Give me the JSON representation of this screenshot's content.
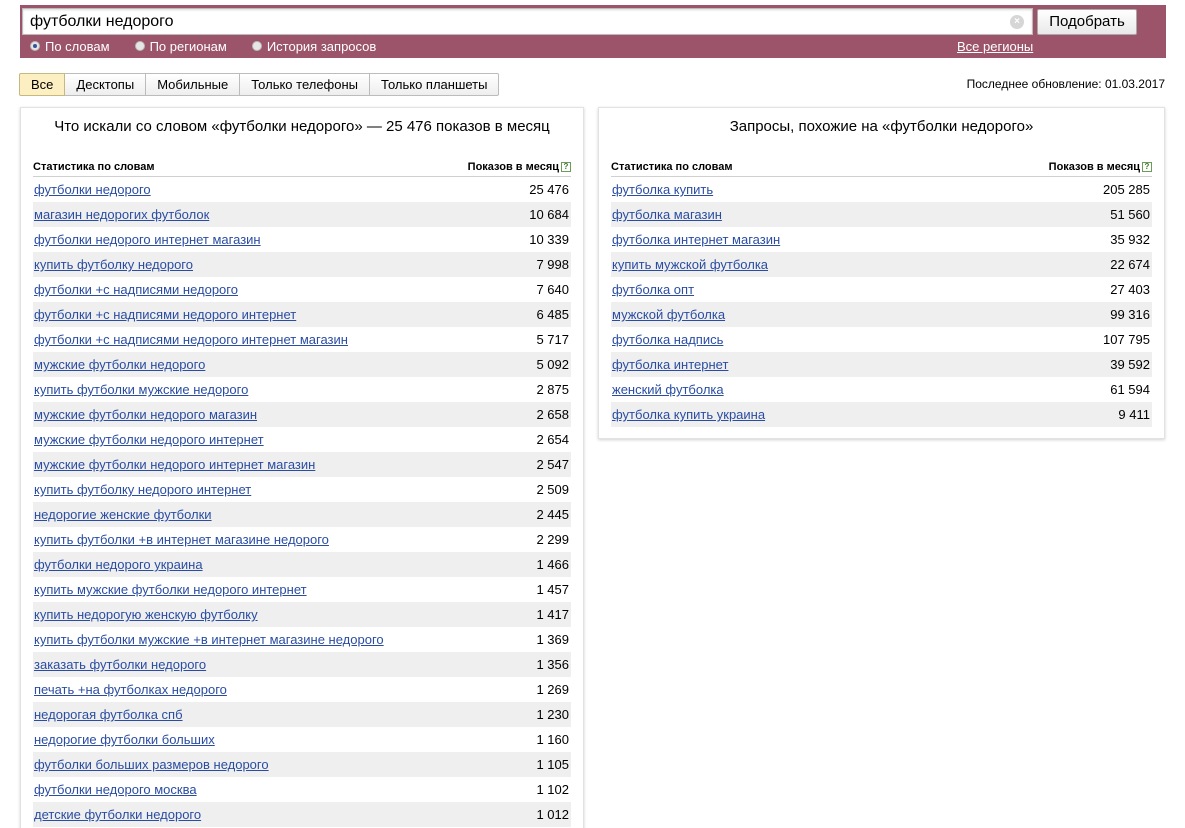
{
  "search": {
    "query": "футболки недорого",
    "button": "Подобрать",
    "clear_icon": "×"
  },
  "modes": [
    {
      "label": "По словам",
      "selected": true
    },
    {
      "label": "По регионам",
      "selected": false
    },
    {
      "label": "История запросов",
      "selected": false
    }
  ],
  "all_regions": "Все регионы",
  "tabs": [
    {
      "label": "Все",
      "active": true
    },
    {
      "label": "Десктопы",
      "active": false
    },
    {
      "label": "Мобильные",
      "active": false
    },
    {
      "label": "Только телефоны",
      "active": false
    },
    {
      "label": "Только планшеты",
      "active": false
    }
  ],
  "last_update": "Последнее обновление: 01.03.2017",
  "left_panel": {
    "title": "Что искали со словом «футболки недорого» — 25 476 показов в месяц",
    "col_words": "Статистика по словам",
    "col_count": "Показов в месяц",
    "help": "?",
    "rows": [
      {
        "query": "футболки недорого",
        "count": "25 476"
      },
      {
        "query": "магазин недорогих футболок",
        "count": "10 684"
      },
      {
        "query": "футболки недорого интернет магазин",
        "count": "10 339"
      },
      {
        "query": "купить футболку недорого",
        "count": "7 998"
      },
      {
        "query": "футболки +с надписями недорого",
        "count": "7 640"
      },
      {
        "query": "футболки +с надписями недорого интернет",
        "count": "6 485"
      },
      {
        "query": "футболки +с надписями недорого интернет магазин",
        "count": "5 717"
      },
      {
        "query": "мужские футболки недорого",
        "count": "5 092"
      },
      {
        "query": "купить футболки мужские недорого",
        "count": "2 875"
      },
      {
        "query": "мужские футболки недорого магазин",
        "count": "2 658"
      },
      {
        "query": "мужские футболки недорого интернет",
        "count": "2 654"
      },
      {
        "query": "мужские футболки недорого интернет магазин",
        "count": "2 547"
      },
      {
        "query": "купить футболку недорого интернет",
        "count": "2 509"
      },
      {
        "query": "недорогие женские футболки",
        "count": "2 445"
      },
      {
        "query": "купить футболки +в интернет магазине недорого",
        "count": "2 299"
      },
      {
        "query": "футболки недорого украина",
        "count": "1 466"
      },
      {
        "query": "купить мужские футболки недорого интернет",
        "count": "1 457"
      },
      {
        "query": "купить недорогую женскую футболку",
        "count": "1 417"
      },
      {
        "query": "купить футболки мужские +в интернет магазине недорого",
        "count": "1 369"
      },
      {
        "query": "заказать футболки недорого",
        "count": "1 356"
      },
      {
        "query": "печать +на футболках недорого",
        "count": "1 269"
      },
      {
        "query": "недорогая футболка спб",
        "count": "1 230"
      },
      {
        "query": "недорогие футболки больших",
        "count": "1 160"
      },
      {
        "query": "футболки больших размеров недорого",
        "count": "1 105"
      },
      {
        "query": "футболки недорого москва",
        "count": "1 102"
      },
      {
        "query": "детские футболки недорого",
        "count": "1 012"
      }
    ]
  },
  "right_panel": {
    "title": "Запросы, похожие на «футболки недорого»",
    "col_words": "Статистика по словам",
    "col_count": "Показов в месяц",
    "help": "?",
    "rows": [
      {
        "query": "футболка купить",
        "count": "205 285"
      },
      {
        "query": "футболка магазин",
        "count": "51 560"
      },
      {
        "query": "футболка интернет магазин",
        "count": "35 932"
      },
      {
        "query": "купить мужской футболка",
        "count": "22 674"
      },
      {
        "query": "футболка опт",
        "count": "27 403"
      },
      {
        "query": "мужской футболка",
        "count": "99 316"
      },
      {
        "query": "футболка надпись",
        "count": "107 795"
      },
      {
        "query": "футболка интернет",
        "count": "39 592"
      },
      {
        "query": "женский футболка",
        "count": "61 594"
      },
      {
        "query": "футболка купить украина",
        "count": "9 411"
      }
    ]
  },
  "colors": {
    "header_band": "#9b5469",
    "link": "#2a4da2",
    "active_tab": "#fcefc2",
    "zebra": "#efefef"
  }
}
